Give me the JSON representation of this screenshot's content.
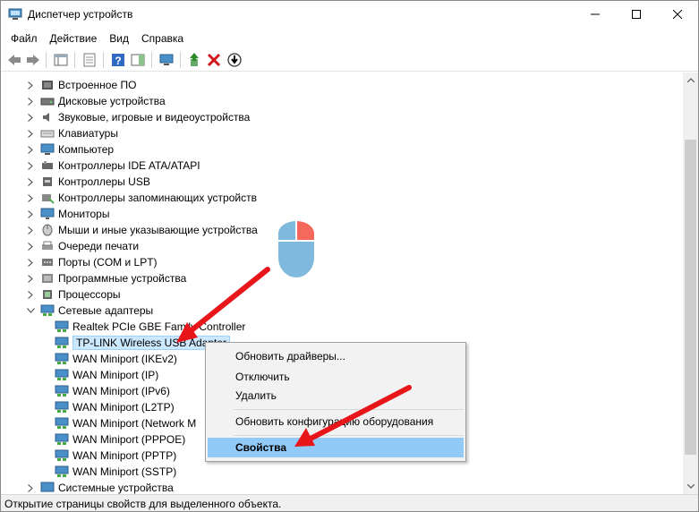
{
  "window": {
    "title": "Диспетчер устройств"
  },
  "menubar": [
    "Файл",
    "Действие",
    "Вид",
    "Справка"
  ],
  "tree": {
    "categories_top": [
      "Встроенное ПО",
      "Дисковые устройства",
      "Звуковые, игровые и видеоустройства",
      "Клавиатуры",
      "Компьютер",
      "Контроллеры IDE ATA/ATAPI",
      "Контроллеры USB",
      "Контроллеры запоминающих устройств",
      "Мониторы",
      "Мыши и иные указывающие устройства",
      "Очереди печати",
      "Порты (COM и LPT)",
      "Программные устройства",
      "Процессоры",
      "Сетевые адаптеры"
    ],
    "network_adapters": [
      "Realtek PCIe GBE Family Controller",
      "TP-LINK Wireless USB Adapter",
      "WAN Miniport (IKEv2)",
      "WAN Miniport (IP)",
      "WAN Miniport (IPv6)",
      "WAN Miniport (L2TP)",
      "WAN Miniport (Network M",
      "WAN Miniport (PPPOE)",
      "WAN Miniport (PPTP)",
      "WAN Miniport (SSTP)"
    ],
    "categories_bottom": [
      "Системные устройства"
    ]
  },
  "context_menu": {
    "update_drivers": "Обновить драйверы...",
    "disable": "Отключить",
    "uninstall": "Удалить",
    "scan_hardware": "Обновить конфигурацию оборудования",
    "properties": "Свойства"
  },
  "statusbar": {
    "text": "Открытие страницы свойств для выделенного объекта."
  },
  "colors": {
    "selection_bg": "#cce8ff",
    "menu_highlight": "#91c9f7",
    "annotation_arrow": "#e8161b",
    "mouse_left": "#7fb9dd",
    "mouse_right": "#f4695c"
  }
}
